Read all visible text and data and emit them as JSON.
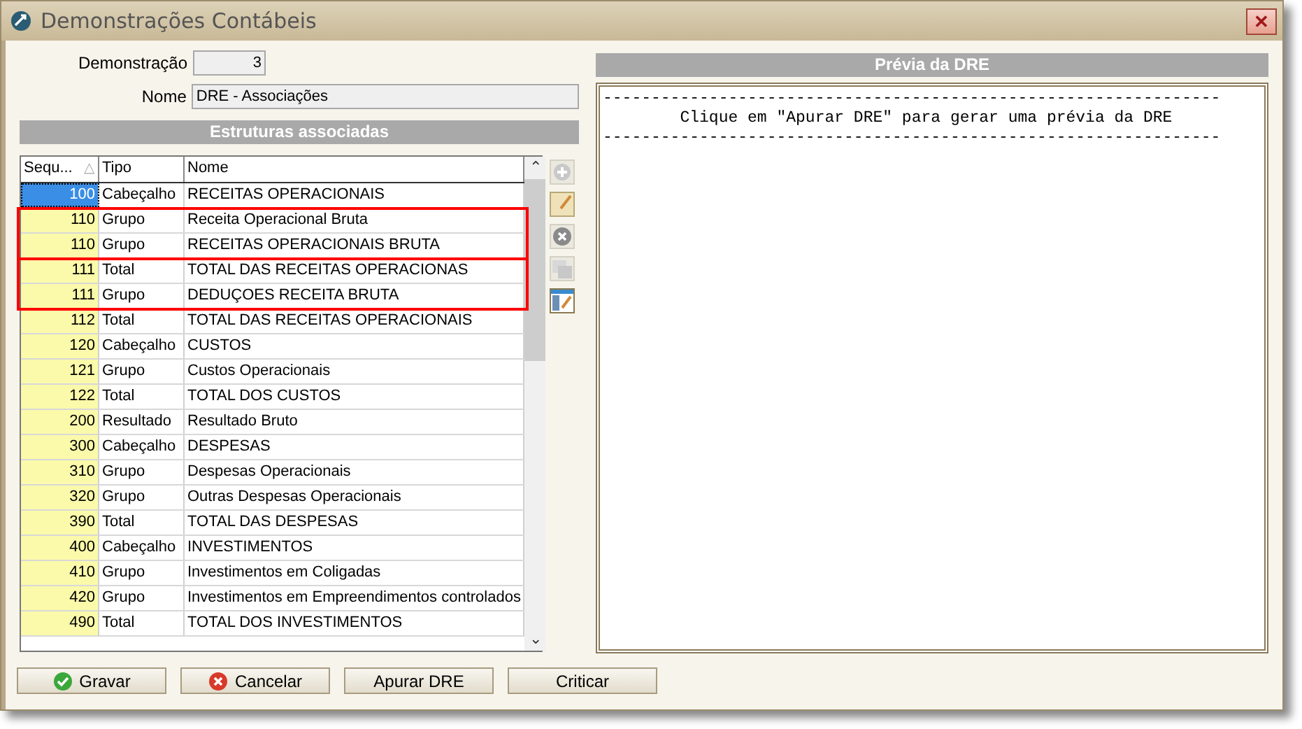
{
  "window": {
    "title": "Demonstrações Contábeis",
    "close": "✕"
  },
  "form": {
    "demonstracao_label": "Demonstração",
    "demonstracao_value": "3",
    "nome_label": "Nome",
    "nome_value": "DRE - Associações"
  },
  "structures": {
    "title": "Estruturas associadas",
    "columns": [
      "Sequ...",
      "Tipo",
      "Nome"
    ],
    "sort_mark": "△",
    "scroll_up": "⌃",
    "scroll_down": "⌄",
    "row_groups": [
      {
        "highlighted": false,
        "rows": [
          {
            "seq": "100",
            "tipo": "Cabeçalho",
            "nome": "RECEITAS OPERACIONAIS",
            "selected": true
          }
        ]
      },
      {
        "highlighted": true,
        "rows": [
          {
            "seq": "110",
            "tipo": "Grupo",
            "nome": "Receita Operacional Bruta",
            "selected": false
          },
          {
            "seq": "110",
            "tipo": "Grupo",
            "nome": "RECEITAS OPERACIONAIS BRUTA",
            "selected": false
          }
        ]
      },
      {
        "highlighted": true,
        "rows": [
          {
            "seq": "111",
            "tipo": "Total",
            "nome": "TOTAL DAS RECEITAS OPERACIONAS",
            "selected": false
          },
          {
            "seq": "111",
            "tipo": "Grupo",
            "nome": "DEDUÇOES RECEITA BRUTA",
            "selected": false
          }
        ]
      },
      {
        "highlighted": false,
        "rows": [
          {
            "seq": "112",
            "tipo": "Total",
            "nome": "TOTAL DAS RECEITAS OPERACIONAIS",
            "selected": false
          },
          {
            "seq": "120",
            "tipo": "Cabeçalho",
            "nome": "CUSTOS",
            "selected": false
          },
          {
            "seq": "121",
            "tipo": "Grupo",
            "nome": "Custos Operacionais",
            "selected": false
          },
          {
            "seq": "122",
            "tipo": "Total",
            "nome": "TOTAL DOS CUSTOS",
            "selected": false
          },
          {
            "seq": "200",
            "tipo": "Resultado",
            "nome": "Resultado Bruto",
            "selected": false
          },
          {
            "seq": "300",
            "tipo": "Cabeçalho",
            "nome": "DESPESAS",
            "selected": false
          },
          {
            "seq": "310",
            "tipo": "Grupo",
            "nome": "Despesas Operacionais",
            "selected": false
          },
          {
            "seq": "320",
            "tipo": "Grupo",
            "nome": "Outras Despesas Operacionais",
            "selected": false
          },
          {
            "seq": "390",
            "tipo": "Total",
            "nome": "TOTAL DAS DESPESAS",
            "selected": false
          },
          {
            "seq": "400",
            "tipo": "Cabeçalho",
            "nome": "INVESTIMENTOS",
            "selected": false
          },
          {
            "seq": "410",
            "tipo": "Grupo",
            "nome": "Investimentos em Coligadas",
            "selected": false
          },
          {
            "seq": "420",
            "tipo": "Grupo",
            "nome": "Investimentos em Empreendimentos controlados",
            "selected": false
          },
          {
            "seq": "490",
            "tipo": "Total",
            "nome": "TOTAL DOS INVESTIMENTOS",
            "selected": false
          }
        ]
      }
    ]
  },
  "preview": {
    "title": "Prévia da DRE",
    "lines": [
      "----------------------------------------------------------------",
      "        Clique em \"Apurar DRE\" para gerar uma prévia da DRE",
      "----------------------------------------------------------------"
    ]
  },
  "buttons": [
    {
      "label": "Gravar",
      "kind": "ok"
    },
    {
      "label": "Cancelar",
      "kind": "cancel"
    },
    {
      "label": "Apurar DRE",
      "kind": "plain"
    },
    {
      "label": "Criticar",
      "kind": "plain"
    }
  ]
}
